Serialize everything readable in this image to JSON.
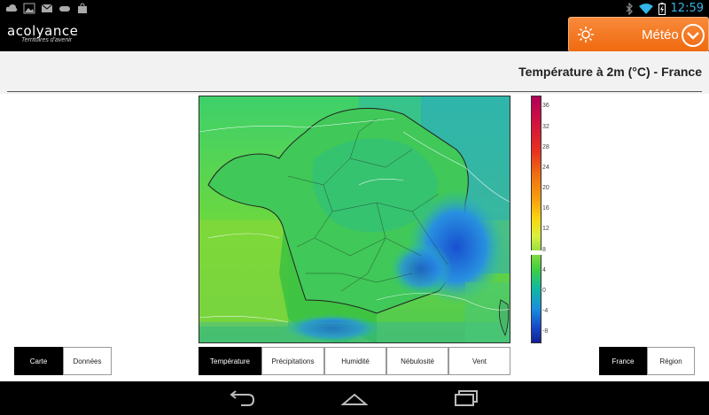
{
  "status_bar": {
    "time": "12:59"
  },
  "app_bar": {
    "logo_main": "acolyance",
    "logo_sub": "Territoires d'avenir",
    "section_button": "Météo"
  },
  "header": {
    "title": "Température à 2m (°C) - France"
  },
  "scale_ticks": [
    "36",
    "32",
    "28",
    "24",
    "20",
    "16",
    "12",
    "8",
    "4",
    "0",
    "-4",
    "-8"
  ],
  "view_toggle": [
    "Carte",
    "Données"
  ],
  "view_selected": "Carte",
  "parameter_tabs": [
    "Température",
    "Précipitations",
    "Humidité",
    "Nébulosité",
    "Vent"
  ],
  "parameter_selected": "Température",
  "area_toggle": [
    "France",
    "Région"
  ],
  "area_selected": "France"
}
